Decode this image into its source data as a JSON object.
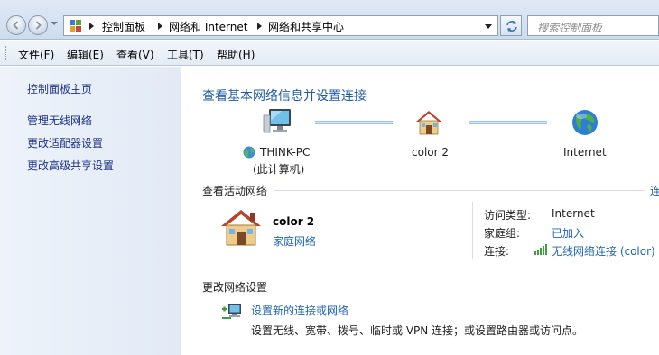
{
  "breadcrumb": {
    "items": [
      "控制面板",
      "网络和 Internet",
      "网络和共享中心"
    ]
  },
  "search": {
    "placeholder": "搜索控制面板"
  },
  "menubar": {
    "items": [
      "文件(F)",
      "编辑(E)",
      "查看(V)",
      "工具(T)",
      "帮助(H)"
    ]
  },
  "sidebar": {
    "items": [
      {
        "label": "控制面板主页"
      },
      {
        "label": "管理无线网络"
      },
      {
        "label": "更改适配器设置"
      },
      {
        "label": "更改高级共享设置"
      }
    ]
  },
  "main": {
    "title": "查看基本网络信息并设置连接",
    "network_map": {
      "computer_name": "THINK-PC",
      "computer_sub": "(此计算机)",
      "network_name": "color  2",
      "internet_label": "Internet"
    },
    "active_networks": {
      "header": "查看活动网络",
      "cut_link": "连",
      "network_name": "color  2",
      "network_type": "家庭网络",
      "access_type_label": "访问类型:",
      "access_type_value": "Internet",
      "homegroup_label": "家庭组:",
      "homegroup_value": "已加入",
      "connection_label": "连接:",
      "connection_value": "无线网络连接 (color)"
    },
    "change_settings": {
      "header": "更改网络设置",
      "setup_link": "设置新的连接或网络",
      "setup_desc": "设置无线、宽带、拨号、临时或 VPN 连接；或设置路由器或访问点。"
    }
  },
  "colors": {
    "link": "#1e64b4",
    "title": "#1e5aa8",
    "sidebar_link": "#1e3287",
    "sidebar_bg": "#e2eaf6"
  }
}
